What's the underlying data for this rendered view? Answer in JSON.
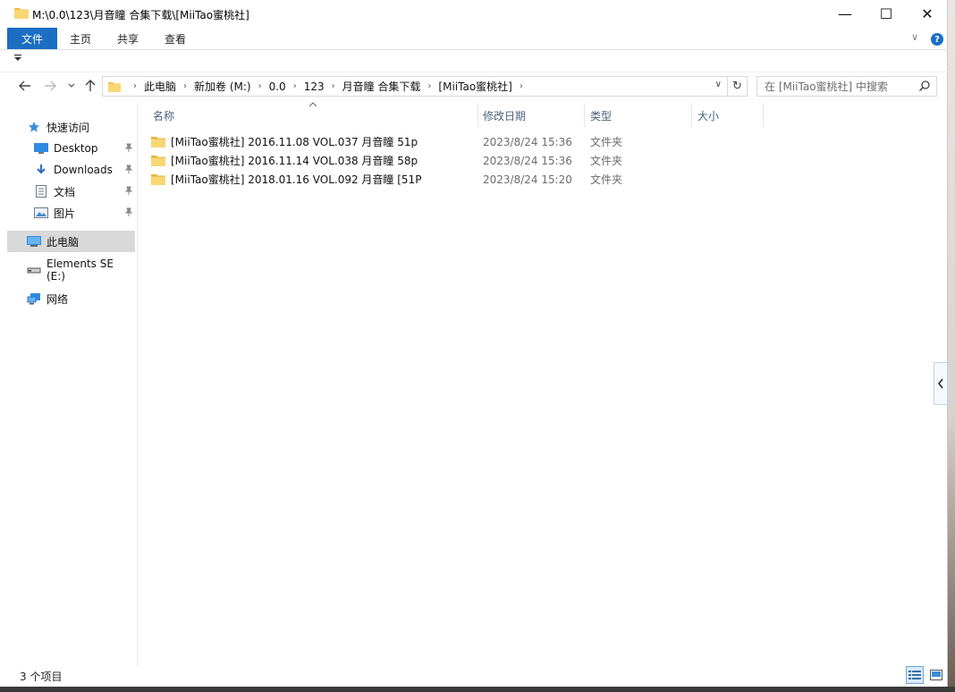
{
  "window": {
    "title": "M:\\0.0\\123\\月音瞳 合集下载\\[MiiTao蜜桃社]",
    "controls": {
      "minimize": "—",
      "maximize": "☐",
      "close": "✕"
    }
  },
  "ribbon": {
    "tabs": [
      "文件",
      "主页",
      "共享",
      "查看"
    ],
    "collapse_glyph": "∨",
    "help_glyph": "?"
  },
  "address": {
    "breadcrumbs": [
      "此电脑",
      "新加卷 (M:)",
      "0.0",
      "123",
      "月音瞳 合集下载",
      "[MiiTao蜜桃社]"
    ],
    "separator": "›",
    "dropdown_glyph": "∨",
    "refresh_glyph": "↻"
  },
  "search": {
    "placeholder": "在 [MiiTao蜜桃社] 中搜索"
  },
  "navpane": {
    "items": [
      {
        "label": "快速访问",
        "icon": "star-icon",
        "pinned": false
      },
      {
        "label": "Desktop",
        "icon": "desktop-icon",
        "pinned": true
      },
      {
        "label": "Downloads",
        "icon": "download-icon",
        "pinned": true
      },
      {
        "label": "文档",
        "icon": "document-icon",
        "pinned": true
      },
      {
        "label": "图片",
        "icon": "pictures-icon",
        "pinned": true
      },
      {
        "label": "此电脑",
        "icon": "computer-icon",
        "pinned": false,
        "selected": true
      },
      {
        "label": "Elements SE (E:)",
        "icon": "drive-icon",
        "pinned": false
      },
      {
        "label": "网络",
        "icon": "network-icon",
        "pinned": false
      }
    ],
    "pin_glyph": "📌"
  },
  "columns": {
    "name": "名称",
    "date": "修改日期",
    "type": "类型",
    "size": "大小",
    "sort_glyph": "^"
  },
  "files": [
    {
      "name": "[MiiTao蜜桃社] 2016.11.08 VOL.037 月音瞳 51p",
      "date": "2023/8/24 15:36",
      "type": "文件夹"
    },
    {
      "name": "[MiiTao蜜桃社] 2016.11.14 VOL.038 月音瞳 58p",
      "date": "2023/8/24 15:36",
      "type": "文件夹"
    },
    {
      "name": "[MiiTao蜜桃社] 2018.01.16 VOL.092 月音瞳 [51P",
      "date": "2023/8/24 15:20",
      "type": "文件夹"
    }
  ],
  "status": {
    "item_count": "3 个项目"
  },
  "colors": {
    "accent": "#1b6ec2",
    "folder": "#f3c04c",
    "selected_bg": "#d9d9d9"
  }
}
